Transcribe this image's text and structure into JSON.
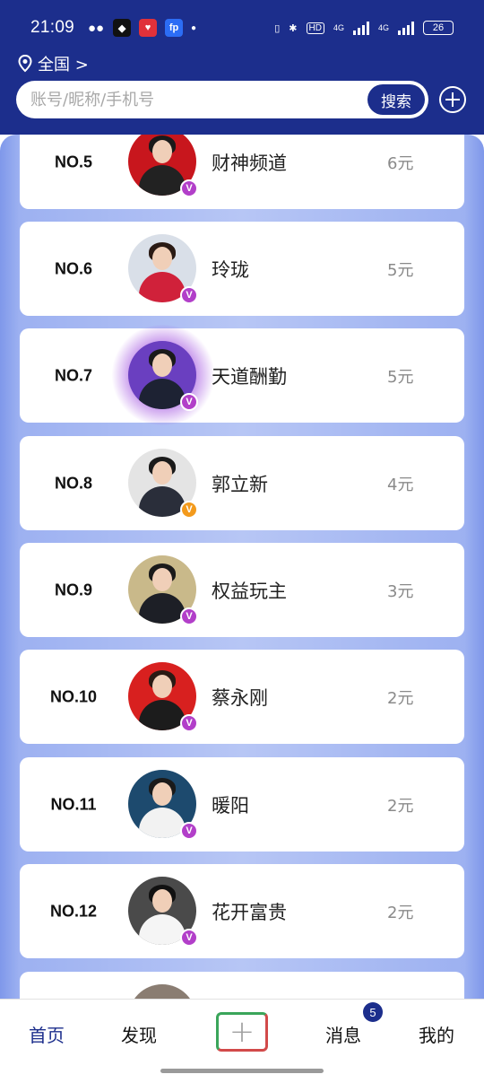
{
  "status_bar": {
    "time": "21:09",
    "hd_label": "HD",
    "net1": "4G",
    "net2": "4G",
    "battery": "26"
  },
  "location": {
    "label": "全国 >"
  },
  "search": {
    "placeholder": "账号/昵称/手机号",
    "button": "搜索"
  },
  "ranking": [
    {
      "rank": "NO.5",
      "name": "财神频道",
      "amount": "6元",
      "badge_color": "#b23fc9"
    },
    {
      "rank": "NO.6",
      "name": "玲珑",
      "amount": "5元",
      "badge_color": "#b23fc9"
    },
    {
      "rank": "NO.7",
      "name": "天道酬勤",
      "amount": "5元",
      "badge_color": "#b23fc9"
    },
    {
      "rank": "NO.8",
      "name": "郭立新",
      "amount": "4元",
      "badge_color": "#f39a1c"
    },
    {
      "rank": "NO.9",
      "name": "权益玩主",
      "amount": "3元",
      "badge_color": "#b23fc9"
    },
    {
      "rank": "NO.10",
      "name": "蔡永刚",
      "amount": "2元",
      "badge_color": "#b23fc9"
    },
    {
      "rank": "NO.11",
      "name": "暖阳",
      "amount": "2元",
      "badge_color": "#b23fc9"
    },
    {
      "rank": "NO.12",
      "name": "花开富贵",
      "amount": "2元",
      "badge_color": "#b23fc9"
    }
  ],
  "nav": {
    "home": "首页",
    "discover": "发现",
    "messages": "消息",
    "messages_badge": "5",
    "mine": "我的"
  },
  "colors": {
    "primary": "#1c2e8c",
    "background_blue": "#b7c6f5"
  }
}
